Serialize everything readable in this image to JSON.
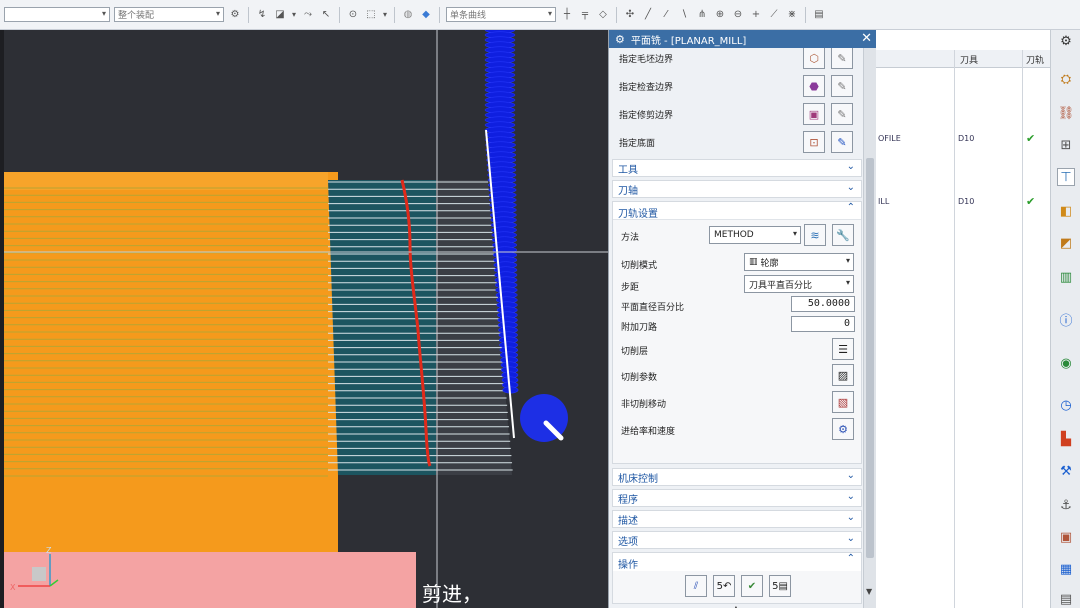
{
  "toolbar": {
    "select1": "",
    "select2": "整个装配",
    "curve_rule": "单条曲线"
  },
  "dialog": {
    "title": "平面铣 - [PLANAR_MILL]",
    "boundaries": [
      {
        "label": "指定毛坯边界",
        "icon": "blank-boundary-icon"
      },
      {
        "label": "指定检查边界",
        "icon": "check-boundary-icon"
      },
      {
        "label": "指定修剪边界",
        "icon": "trim-boundary-icon"
      },
      {
        "label": "指定底面",
        "icon": "floor-icon"
      }
    ],
    "sections_top": [
      {
        "label": "工具"
      },
      {
        "label": "刀轴"
      }
    ],
    "path_settings": {
      "header": "刀轨设置",
      "method_label": "方法",
      "method_value": "METHOD",
      "cut_pattern_label": "切削模式",
      "cut_pattern_value": "轮廓",
      "stepover_label": "步距",
      "stepover_value": "刀具平直百分比",
      "flat_diameter_label": "平面直径百分比",
      "flat_diameter_value": "50.0000",
      "additional_passes_label": "附加刀路",
      "additional_passes_value": "0",
      "cut_levels_label": "切削层",
      "cut_params_label": "切削参数",
      "non_cutting_label": "非切削移动",
      "feeds_label": "进给率和速度"
    },
    "sections_bottom": [
      {
        "label": "机床控制"
      },
      {
        "label": "程序"
      },
      {
        "label": "描述"
      },
      {
        "label": "选项"
      }
    ],
    "actions_header": "操作"
  },
  "nav_table": {
    "col_tool": "刀具",
    "col_path": "刀轨",
    "rows": [
      {
        "name": "OFILE",
        "tool": "D10",
        "status": "✔"
      },
      {
        "name": "ILL",
        "tool": "D10",
        "status": "✔"
      }
    ]
  },
  "subtitle": "剪进，",
  "colors": {
    "part_orange": "#f59a1c",
    "toolpath_blue": "#0f1fe0",
    "path_red": "#e02a1a",
    "accent": "#3b6ea5"
  }
}
